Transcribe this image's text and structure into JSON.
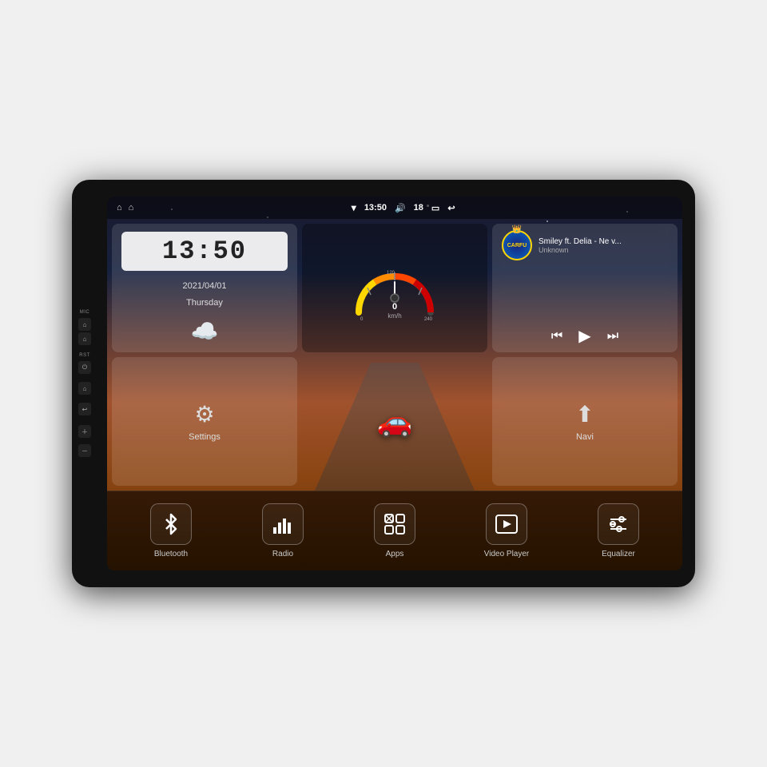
{
  "device": {
    "title": "Car Head Unit"
  },
  "statusBar": {
    "wifi_icon": "▼",
    "time": "13:50",
    "volume_icon": "🔊",
    "volume_level": "18",
    "battery_icon": "▭",
    "back_icon": "↩"
  },
  "sideButtons": {
    "mic_label": "MIC",
    "rst_label": "RST",
    "power_icon": "⏻",
    "home_icon": "⌂",
    "back_icon": "↩",
    "volup_icon": "+",
    "voldown_icon": "-"
  },
  "clock": {
    "time": "13:50",
    "date": "2021/04/01",
    "day": "Thursday"
  },
  "music": {
    "title": "Smiley ft. Delia - Ne v...",
    "artist": "Unknown",
    "logo_text": "CARFU"
  },
  "settings": {
    "label": "Settings"
  },
  "navi": {
    "label": "Navi"
  },
  "speedometer": {
    "speed": "0",
    "unit": "km/h",
    "max": "240"
  },
  "bottomBar": {
    "items": [
      {
        "id": "bluetooth",
        "label": "Bluetooth",
        "icon": "bluetooth"
      },
      {
        "id": "radio",
        "label": "Radio",
        "icon": "radio"
      },
      {
        "id": "apps",
        "label": "Apps",
        "icon": "apps"
      },
      {
        "id": "video",
        "label": "Video Player",
        "icon": "video"
      },
      {
        "id": "equalizer",
        "label": "Equalizer",
        "icon": "equalizer"
      }
    ]
  },
  "colors": {
    "accent": "#ffd700",
    "screen_bg_top": "#1a1a2e",
    "screen_bg_mid": "#a0522d",
    "screen_bg_bot": "#5c2e00"
  }
}
